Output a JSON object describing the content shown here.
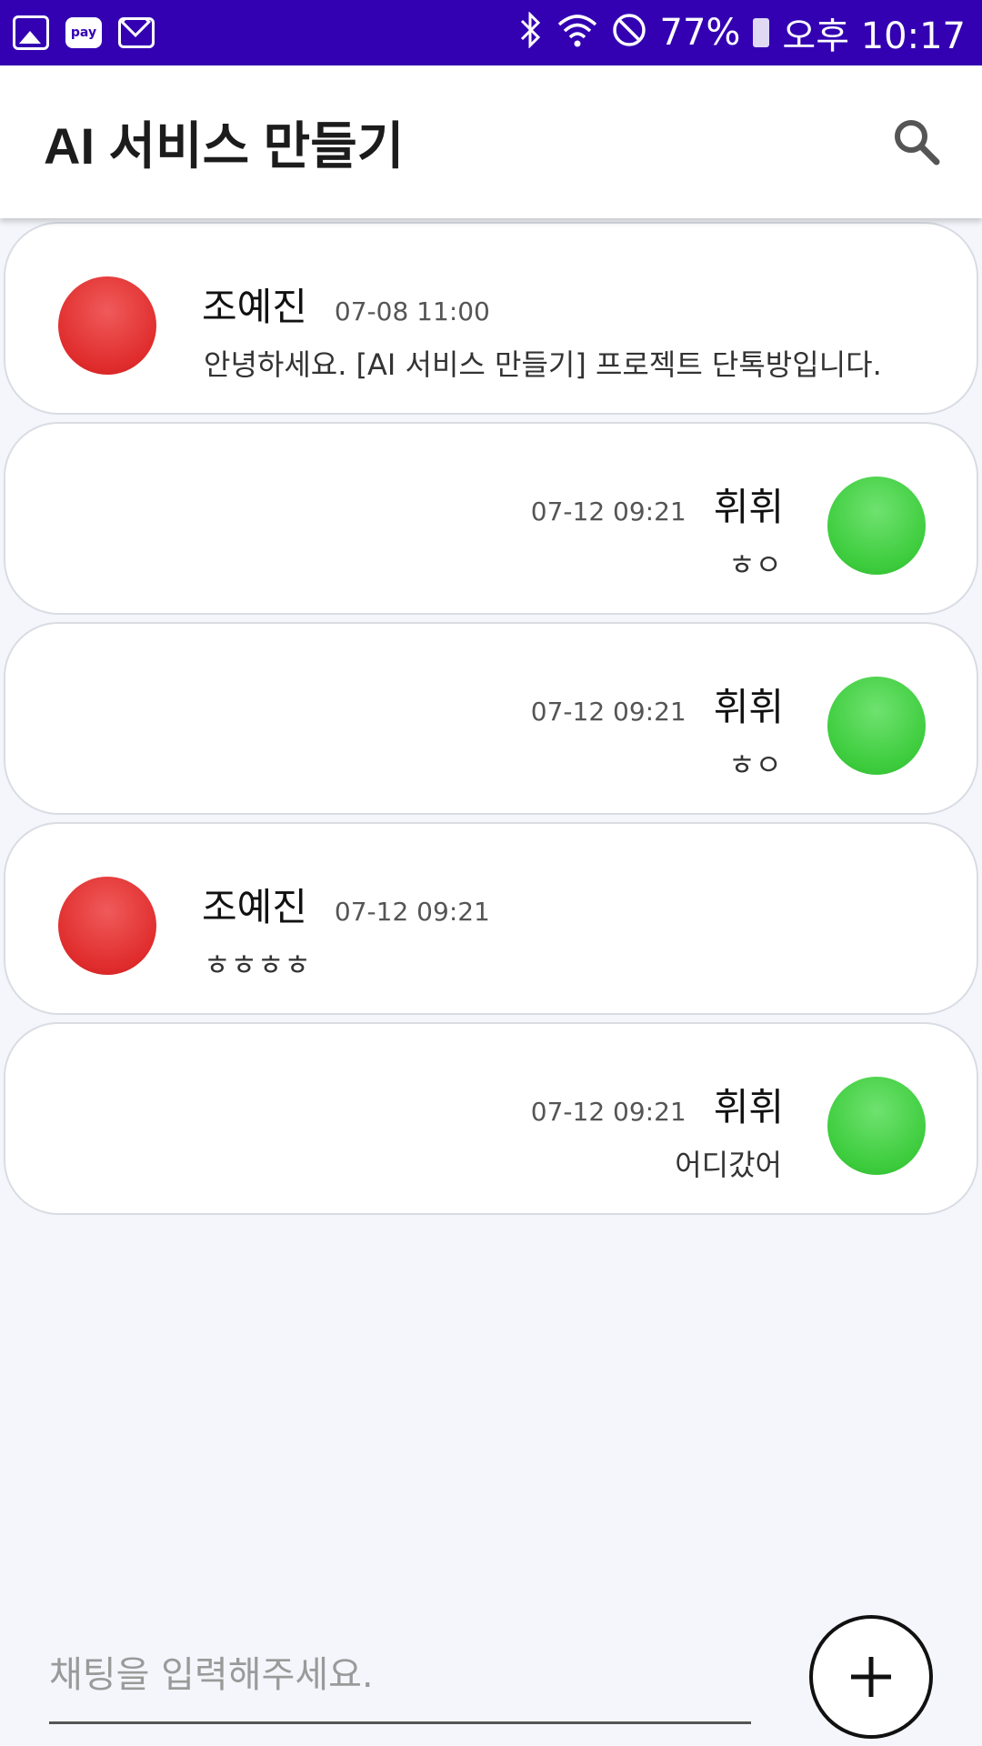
{
  "status_bar": {
    "battery_percent": "77%",
    "time": "오후 10:17",
    "left_icons": [
      "gallery-icon",
      "pay-icon",
      "mail-icon"
    ],
    "right_icons": [
      "bluetooth-icon",
      "wifi-icon",
      "do-not-disturb-icon",
      "battery-icon"
    ],
    "pay_label": "pay",
    "background_color": "#3300b2"
  },
  "app_bar": {
    "title": "AI 서비스 만들기",
    "search_icon": "search-icon"
  },
  "messages": [
    {
      "side": "left",
      "sender": "조예진",
      "time": "07-08 11:00",
      "text": "안녕하세요. [AI 서비스 만들기] 프로젝트 단톡방입니다.",
      "avatar_color": "#e02c2c"
    },
    {
      "side": "right",
      "sender": "휘휘",
      "time": "07-12 09:21",
      "text": "ㅎㅇ",
      "avatar_color": "#3ccc3c"
    },
    {
      "side": "right",
      "sender": "휘휘",
      "time": "07-12 09:21",
      "text": "ㅎㅇ",
      "avatar_color": "#3ccc3c"
    },
    {
      "side": "left",
      "sender": "조예진",
      "time": "07-12 09:21",
      "text": "ㅎㅎㅎㅎ",
      "avatar_color": "#e02c2c"
    },
    {
      "side": "right",
      "sender": "휘휘",
      "time": "07-12 09:21",
      "text": "어디갔어",
      "avatar_color": "#3ccc3c"
    }
  ],
  "composer": {
    "value": "",
    "placeholder": "채팅을 입력해주세요.",
    "add_icon": "plus-icon"
  }
}
